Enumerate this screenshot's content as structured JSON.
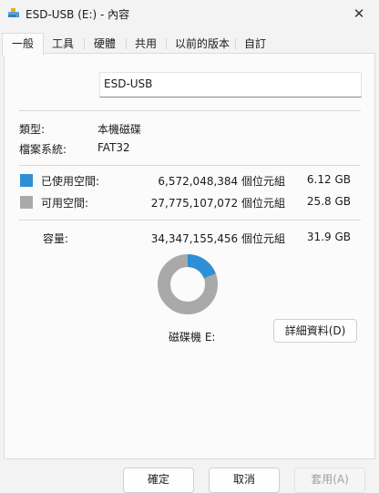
{
  "window": {
    "title": "ESD-USB (E:) - 內容",
    "close_glyph": "✕",
    "icon": "drive-icon"
  },
  "tabs": [
    {
      "label": "一般",
      "active": true
    },
    {
      "label": "工具",
      "active": false
    },
    {
      "label": "硬體",
      "active": false
    },
    {
      "label": "共用",
      "active": false
    },
    {
      "label": "以前的版本",
      "active": false
    },
    {
      "label": "自訂",
      "active": false
    }
  ],
  "general": {
    "name_value": "ESD-USB",
    "type_label": "類型:",
    "type_value": "本機磁碟",
    "fs_label": "檔案系統:",
    "fs_value": "FAT32",
    "used": {
      "label": "已使用空間:",
      "bytes": "6,572,048,384 個位元組",
      "size": "6.12 GB",
      "color": "#2e8fd6"
    },
    "free": {
      "label": "可用空間:",
      "bytes": "27,775,107,072 個位元組",
      "size": "25.8 GB",
      "color": "#a9a9a9"
    },
    "capacity": {
      "label": "容量:",
      "bytes": "34,347,155,456 個位元組",
      "size": "31.9 GB"
    },
    "drive_label": "磁碟機 E:",
    "details_button": "詳細資料(D)",
    "used_fraction": 0.1913
  },
  "buttons": {
    "ok": "確定",
    "cancel": "取消",
    "apply": "套用(A)"
  }
}
